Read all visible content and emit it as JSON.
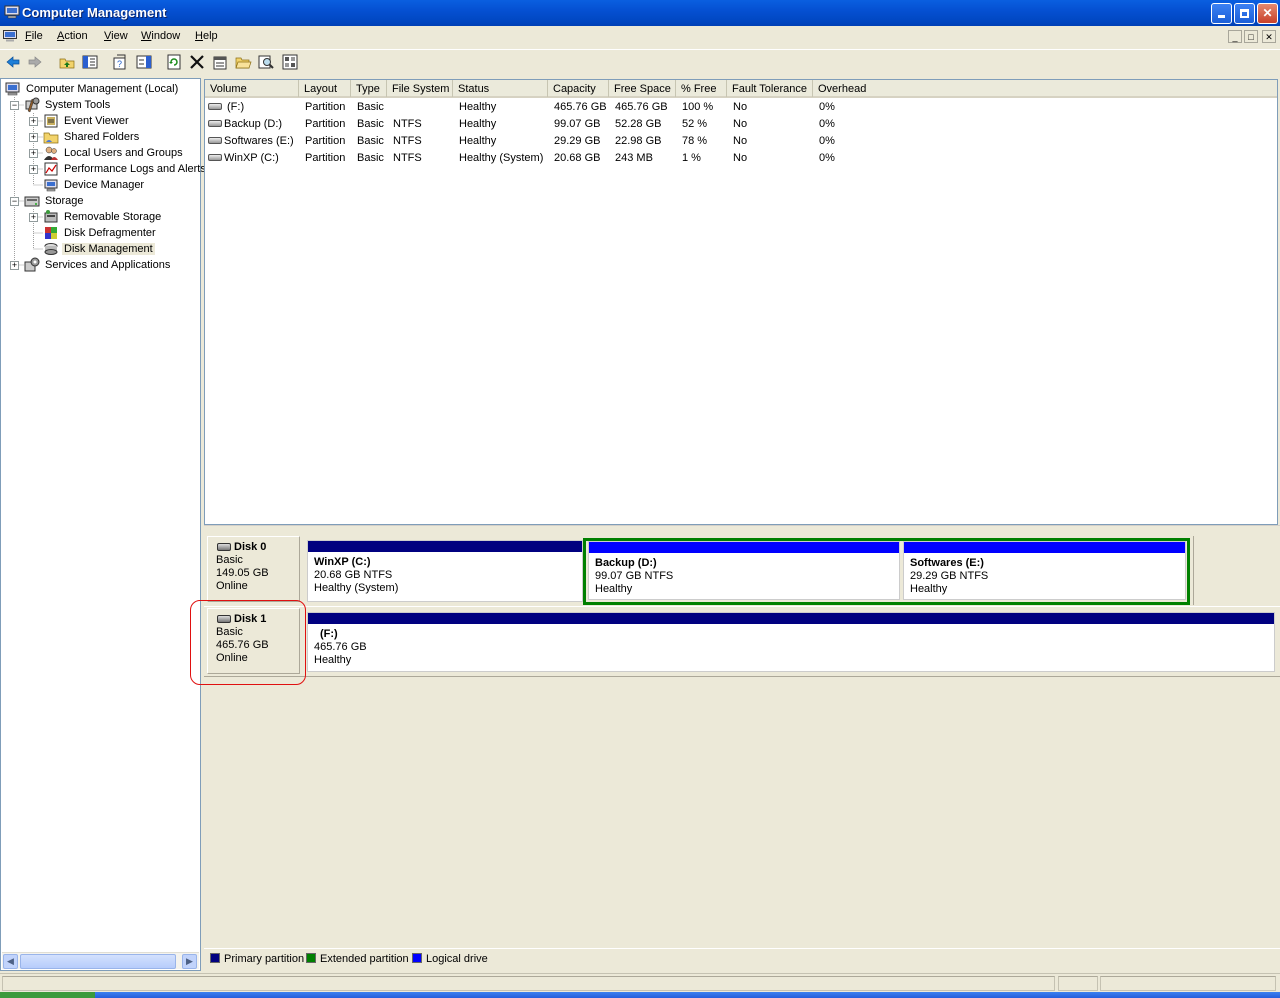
{
  "window": {
    "title": "Computer Management",
    "controls": {
      "minimize": "_",
      "maximize": "□",
      "close": "✕"
    }
  },
  "menu": [
    {
      "label": "File",
      "accel": "F",
      "rest": "ile"
    },
    {
      "label": "Action",
      "accel": "A",
      "rest": "ction"
    },
    {
      "label": "View",
      "accel": "V",
      "rest": "iew"
    },
    {
      "label": "Window",
      "accel": "W",
      "rest": "indow"
    },
    {
      "label": "Help",
      "accel": "H",
      "rest": "elp"
    }
  ],
  "toolbar": [
    "back-arrow-icon",
    "forward-arrow-icon",
    "up-folder-icon",
    "show-hide-tree-icon",
    "properties-icon",
    "show-hide-action-pane-icon",
    "refresh-icon",
    "delete-icon",
    "properties-sheet-icon",
    "open-folder-icon",
    "search-icon",
    "settings-icon"
  ],
  "tree": {
    "root": "Computer Management (Local)",
    "system_tools": "System Tools",
    "event_viewer": "Event Viewer",
    "shared_folders": "Shared Folders",
    "local_users": "Local Users and Groups",
    "perf_logs": "Performance Logs and Alerts",
    "device_manager": "Device Manager",
    "storage": "Storage",
    "removable_storage": "Removable Storage",
    "disk_defrag": "Disk Defragmenter",
    "disk_management": "Disk Management",
    "services_apps": "Services and Applications"
  },
  "volume_list": {
    "columns": [
      "Volume",
      "Layout",
      "Type",
      "File System",
      "Status",
      "Capacity",
      "Free Space",
      "% Free",
      "Fault Tolerance",
      "Overhead"
    ],
    "rows": [
      [
        "(F:)",
        "Partition",
        "Basic",
        "",
        "Healthy",
        "465.76 GB",
        "465.76 GB",
        "100 %",
        "No",
        "0%"
      ],
      [
        "Backup (D:)",
        "Partition",
        "Basic",
        "NTFS",
        "Healthy",
        "99.07 GB",
        "52.28 GB",
        "52 %",
        "No",
        "0%"
      ],
      [
        "Softwares (E:)",
        "Partition",
        "Basic",
        "NTFS",
        "Healthy",
        "29.29 GB",
        "22.98 GB",
        "78 %",
        "No",
        "0%"
      ],
      [
        "WinXP (C:)",
        "Partition",
        "Basic",
        "NTFS",
        "Healthy (System)",
        "20.68 GB",
        "243 MB",
        "1 %",
        "No",
        "0%"
      ]
    ]
  },
  "disks": [
    {
      "name": "Disk 0",
      "type": "Basic",
      "size": "149.05 GB",
      "status": "Online",
      "partitions": [
        {
          "name": "WinXP  (C:)",
          "detail": "20.68 GB NTFS",
          "status": "Healthy (System)",
          "kind": "primary"
        },
        {
          "name": "Backup  (D:)",
          "detail": "99.07 GB NTFS",
          "status": "Healthy",
          "kind": "logical"
        },
        {
          "name": "Softwares  (E:)",
          "detail": "29.29 GB NTFS",
          "status": "Healthy",
          "kind": "logical"
        }
      ]
    },
    {
      "name": "Disk 1",
      "type": "Basic",
      "size": "465.76 GB",
      "status": "Online",
      "partitions": [
        {
          "name": "(F:)",
          "detail": "465.76 GB",
          "status": "Healthy",
          "kind": "primary"
        }
      ]
    }
  ],
  "legend": [
    {
      "label": "Primary partition",
      "color": "#000080"
    },
    {
      "label": "Extended partition",
      "color": "#008000"
    },
    {
      "label": "Logical drive",
      "color": "#0000FF"
    }
  ],
  "colors": {
    "primary": "#000080",
    "extended": "#008000",
    "logical": "#0000FF",
    "highlight": "#E01010",
    "titlebar": "#0550D2"
  }
}
